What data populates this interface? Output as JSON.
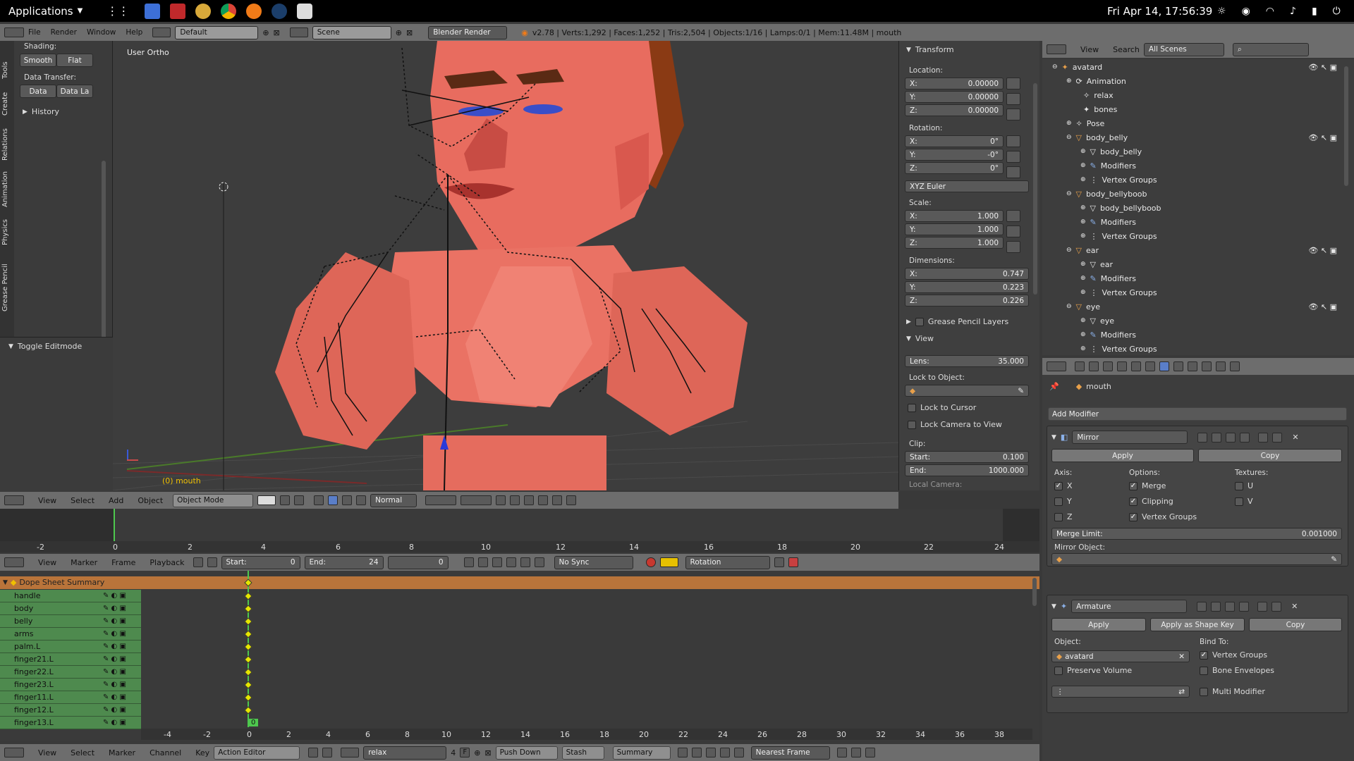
{
  "sysbar": {
    "applications": "Applications",
    "datetime": "Fri Apr 14, 17:56:39"
  },
  "info": {
    "menus": [
      "File",
      "Render",
      "Window",
      "Help"
    ],
    "layout": "Default",
    "scene": "Scene",
    "engine": "Blender Render",
    "stats": "v2.78 | Verts:1,292 | Faces:1,252 | Tris:2,504 | Objects:1/16 | Lamps:0/1 | Mem:11.48M | mouth"
  },
  "tools": {
    "tabs": [
      "Tools",
      "Create",
      "Relations",
      "Animation",
      "Physics",
      "Grease Pencil"
    ],
    "shading_label": "Shading:",
    "smooth": "Smooth",
    "flat": "Flat",
    "data_transfer_label": "Data Transfer:",
    "data": "Data",
    "data_la": "Data La",
    "history": "History",
    "toggle_editmode": "Toggle Editmode"
  },
  "viewport": {
    "view_name": "User Ortho",
    "object_label": "(0) mouth",
    "menus": [
      "View",
      "Select",
      "Add",
      "Object"
    ],
    "mode": "Object Mode",
    "pivot": "Normal"
  },
  "npanel": {
    "transform": "Transform",
    "location": "Location:",
    "loc": [
      {
        "k": "X:",
        "v": "0.00000"
      },
      {
        "k": "Y:",
        "v": "0.00000"
      },
      {
        "k": "Z:",
        "v": "0.00000"
      }
    ],
    "rotation": "Rotation:",
    "rot": [
      {
        "k": "X:",
        "v": "0°"
      },
      {
        "k": "Y:",
        "v": "-0°"
      },
      {
        "k": "Z:",
        "v": "0°"
      }
    ],
    "euler": "XYZ Euler",
    "scale": "Scale:",
    "scl": [
      {
        "k": "X:",
        "v": "1.000"
      },
      {
        "k": "Y:",
        "v": "1.000"
      },
      {
        "k": "Z:",
        "v": "1.000"
      }
    ],
    "dimensions": "Dimensions:",
    "dim": [
      {
        "k": "X:",
        "v": "0.747"
      },
      {
        "k": "Y:",
        "v": "0.223"
      },
      {
        "k": "Z:",
        "v": "0.226"
      }
    ],
    "grease": "Grease Pencil Layers",
    "view": "View",
    "lens_k": "Lens:",
    "lens_v": "35.000",
    "lock_obj": "Lock to Object:",
    "lock_cursor": "Lock to Cursor",
    "lock_camera": "Lock Camera to View",
    "clip": "Clip:",
    "clip_start_k": "Start:",
    "clip_start_v": "0.100",
    "clip_end_k": "End:",
    "clip_end_v": "1000.000",
    "local_camera": "Local Camera:"
  },
  "timeline": {
    "ruler": [
      "-2",
      "0",
      "2",
      "4",
      "6",
      "8",
      "10",
      "12",
      "14",
      "16",
      "18",
      "20",
      "22",
      "24"
    ],
    "menus": [
      "View",
      "Marker",
      "Frame",
      "Playback"
    ],
    "start": "Start:",
    "start_v": "0",
    "end": "End:",
    "end_v": "24",
    "current": "0",
    "sync": "No Sync",
    "keying": "Rotation"
  },
  "dopesheet": {
    "summary": "Dope Sheet Summary",
    "channels": [
      "handle",
      "body",
      "belly",
      "arms",
      "palm.L",
      "finger21.L",
      "finger22.L",
      "finger23.L",
      "finger11.L",
      "finger12.L",
      "finger13.L"
    ],
    "ruler": [
      "-4",
      "-2",
      "0",
      "2",
      "4",
      "6",
      "8",
      "10",
      "12",
      "14",
      "16",
      "18",
      "20",
      "22",
      "24",
      "26",
      "28",
      "30",
      "32",
      "34",
      "36",
      "38"
    ],
    "frame_badge": "0",
    "menus": [
      "View",
      "Select",
      "Marker",
      "Channel",
      "Key"
    ],
    "mode": "Action Editor",
    "action": "relax",
    "users": "4",
    "f": "F",
    "push_down": "Push Down",
    "stash": "Stash",
    "summary_btn": "Summary",
    "snap": "Nearest Frame"
  },
  "outliner": {
    "menus": [
      "View",
      "Search"
    ],
    "filter": "All Scenes",
    "items": [
      {
        "t": "avatard",
        "d": 0
      },
      {
        "t": "Animation",
        "d": 1
      },
      {
        "t": "relax",
        "d": 2
      },
      {
        "t": "bones",
        "d": 1
      },
      {
        "t": "Pose",
        "d": 1
      },
      {
        "t": "body_belly",
        "d": 0
      },
      {
        "t": "body_belly",
        "d": 1
      },
      {
        "t": "Modifiers",
        "d": 1
      },
      {
        "t": "Vertex Groups",
        "d": 1
      },
      {
        "t": "body_bellyboob",
        "d": 0
      },
      {
        "t": "body_bellyboob",
        "d": 1
      },
      {
        "t": "Modifiers",
        "d": 1
      },
      {
        "t": "Vertex Groups",
        "d": 1
      },
      {
        "t": "ear",
        "d": 0
      },
      {
        "t": "ear",
        "d": 1
      },
      {
        "t": "Modifiers",
        "d": 1
      },
      {
        "t": "Vertex Groups",
        "d": 1
      },
      {
        "t": "eye",
        "d": 0
      },
      {
        "t": "eye",
        "d": 1
      },
      {
        "t": "Modifiers",
        "d": 1
      },
      {
        "t": "Vertex Groups",
        "d": 1
      }
    ]
  },
  "props": {
    "object": "mouth",
    "add_modifier": "Add Modifier",
    "mirror": "Mirror",
    "apply": "Apply",
    "copy": "Copy",
    "axis": "Axis:",
    "options": "Options:",
    "textures": "Textures:",
    "x": "X",
    "y": "Y",
    "z": "Z",
    "merge": "Merge",
    "clipping": "Clipping",
    "vertex_groups": "Vertex Groups",
    "u": "U",
    "v": "V",
    "merge_limit": "Merge Limit:",
    "merge_limit_v": "0.001000",
    "mirror_object": "Mirror Object:",
    "armature": "Armature",
    "apply2": "Apply",
    "apply_shape": "Apply as Shape Key",
    "copy2": "Copy",
    "object_label": "Object:",
    "bind_to": "Bind To:",
    "arm_object": "avatard",
    "bind_vg": "Vertex Groups",
    "bone_env": "Bone Envelopes",
    "preserve": "Preserve Volume",
    "multi": "Multi Modifier"
  }
}
